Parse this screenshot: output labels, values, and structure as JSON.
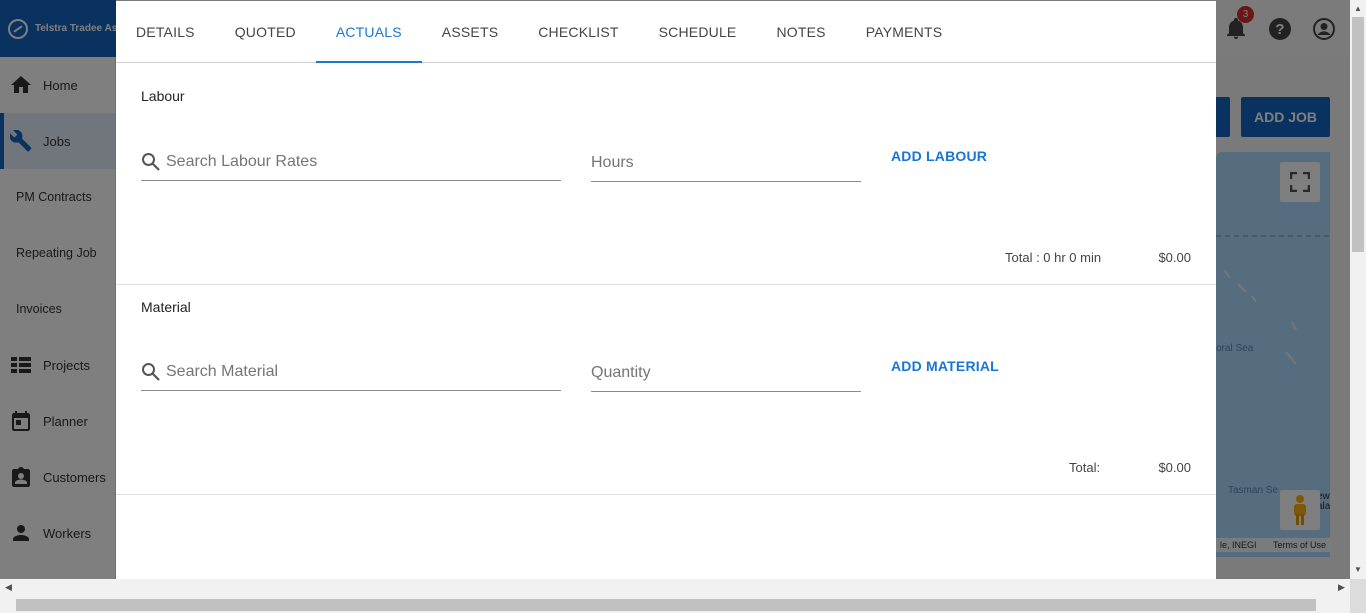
{
  "app": {
    "brand_name": "Telstra Tradee Ass",
    "notification_count": "3"
  },
  "sidebar": {
    "items": [
      {
        "label": "Home",
        "icon": "home-icon"
      },
      {
        "label": "Jobs",
        "icon": "wrench-icon",
        "active": true
      },
      {
        "label": "PM Contracts"
      },
      {
        "label": "Repeating Job"
      },
      {
        "label": "Invoices"
      },
      {
        "label": "Projects",
        "icon": "list-icon"
      },
      {
        "label": "Planner",
        "icon": "calendar-icon"
      },
      {
        "label": "Customers",
        "icon": "contacts-icon"
      },
      {
        "label": "Workers",
        "icon": "person-icon"
      }
    ]
  },
  "page": {
    "add_job_label": "ADD JOB"
  },
  "map": {
    "coral_sea": "oral Sea",
    "tasman_sea": "Tasman Se",
    "attribution": "le, INEGI",
    "terms": "Terms of Use",
    "nz_partial": "ew ala"
  },
  "dialog": {
    "tabs": [
      {
        "label": "DETAILS"
      },
      {
        "label": "QUOTED"
      },
      {
        "label": "ACTUALS",
        "active": true
      },
      {
        "label": "ASSETS"
      },
      {
        "label": "CHECKLIST"
      },
      {
        "label": "SCHEDULE"
      },
      {
        "label": "NOTES"
      },
      {
        "label": "PAYMENTS"
      }
    ],
    "labour": {
      "title": "Labour",
      "search_placeholder": "Search Labour Rates",
      "hours_placeholder": "Hours",
      "add_label": "ADD LABOUR",
      "total_label": "Total : 0 hr 0 min",
      "total_value": "$0.00"
    },
    "material": {
      "title": "Material",
      "search_placeholder": "Search Material",
      "quantity_placeholder": "Quantity",
      "add_label": "ADD MATERIAL",
      "total_label": "Total:",
      "total_value": "$0.00"
    }
  },
  "colors": {
    "accent": "#1976d2",
    "brand": "#1565c0",
    "badge": "#d32f2f"
  }
}
